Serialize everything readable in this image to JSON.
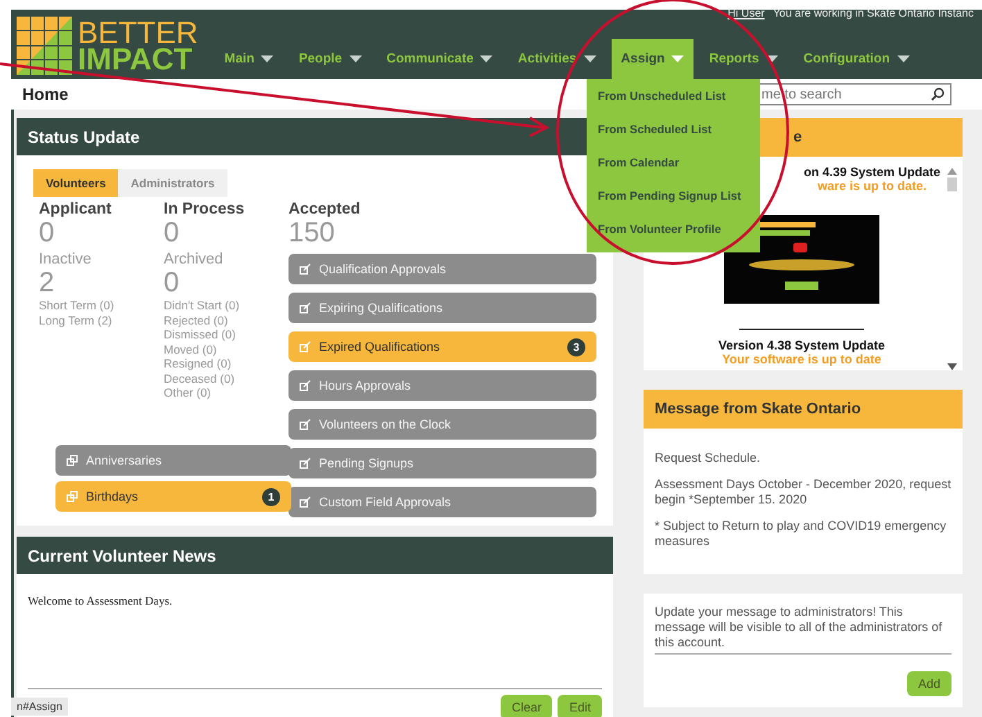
{
  "top_bar": {
    "user_link": "Hi User",
    "context": "You are working in  Skate Ontario Instanc"
  },
  "logo": {
    "line1": "BETTER",
    "line2": "IMPACT"
  },
  "nav": [
    {
      "label": "Main",
      "selected": false
    },
    {
      "label": "People",
      "selected": false
    },
    {
      "label": "Communicate",
      "selected": false
    },
    {
      "label": "Activities",
      "selected": false
    },
    {
      "label": "Assign",
      "selected": true
    },
    {
      "label": "Reports",
      "selected": false
    },
    {
      "label": "Configuration",
      "selected": false
    }
  ],
  "assign_menu": [
    "From Unscheduled List",
    "From Scheduled List",
    "From Calendar",
    "From Pending Signup List",
    "From Volunteer Profile"
  ],
  "page_title": "Home",
  "search": {
    "placeholder": "me to search"
  },
  "status_update": {
    "title": "Status Update",
    "tabs": [
      {
        "label": "Volunteers",
        "selected": true
      },
      {
        "label": "Administrators",
        "selected": false
      }
    ],
    "columns": [
      {
        "heading": "Applicant",
        "count": "0",
        "sub_heading": "Inactive",
        "sub_count": "2",
        "details": [
          "Short Term (0)",
          "Long Term (2)"
        ]
      },
      {
        "heading": "In Process",
        "count": "0",
        "sub_heading": "Archived",
        "sub_count": "0",
        "details": [
          "Didn't Start (0)",
          "Rejected (0)",
          "Dismissed (0)",
          "Moved (0)",
          "Resigned (0)",
          "Deceased (0)",
          "Other (0)"
        ]
      },
      {
        "heading": "Accepted",
        "count": "150"
      }
    ],
    "accepted_links": [
      {
        "label": "Qualification Approvals",
        "highlighted": false
      },
      {
        "label": "Expiring Qualifications",
        "highlighted": false
      },
      {
        "label": "Expired Qualifications",
        "highlighted": true,
        "badge": "3"
      },
      {
        "label": "Hours Approvals",
        "highlighted": false
      },
      {
        "label": "Volunteers on the Clock",
        "highlighted": false
      },
      {
        "label": "Pending Signups",
        "highlighted": false
      },
      {
        "label": "Custom Field Approvals",
        "highlighted": false
      }
    ],
    "side_links": [
      {
        "label": "Anniversaries",
        "highlighted": false
      },
      {
        "label": "Birthdays",
        "highlighted": true,
        "badge": "1"
      }
    ]
  },
  "news": {
    "title": "Current Volunteer News",
    "text": "Welcome to Assessment Days.",
    "buttons": [
      "Clear",
      "Edit"
    ]
  },
  "updates_panel": {
    "title_visible": "e",
    "items": [
      {
        "title": "on 4.39 System Update",
        "status": "ware is up to date."
      },
      {
        "title": "Version 4.38 System Update",
        "status": "Your software is up to date"
      }
    ]
  },
  "message": {
    "title": "Message from Skate Ontario",
    "paragraphs": [
      "Request Schedule.",
      "Assessment Days October - December 2020, request begin *September 15. 2020",
      "* Subject to Return to play and COVID19 emergency measures"
    ]
  },
  "admin_message": {
    "text": "Update your message to administrators! This message will be visible to all of the administrators of this account.",
    "button": "Add"
  },
  "status_bar": "n#Assign"
}
